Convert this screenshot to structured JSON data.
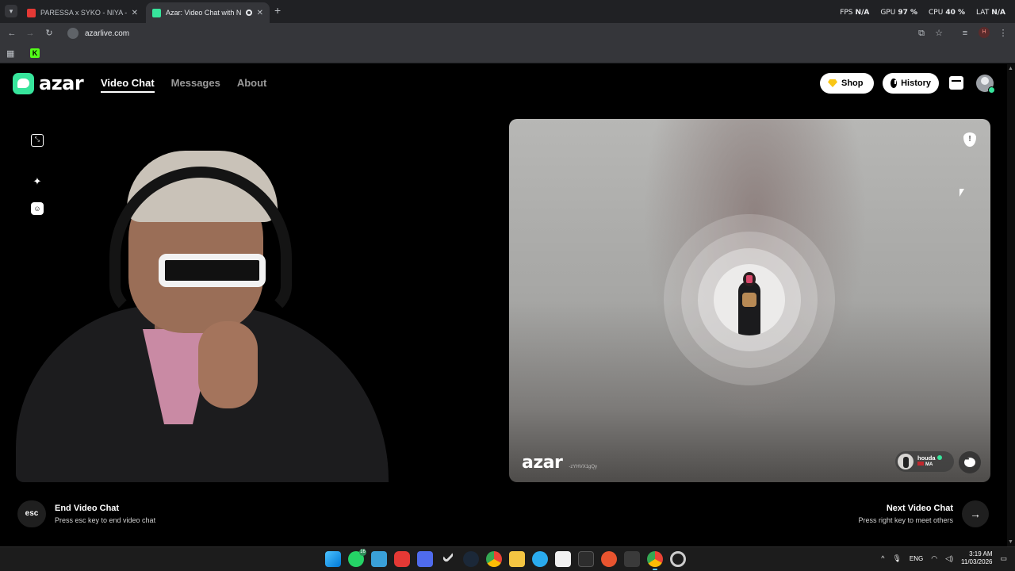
{
  "browser": {
    "tab_menu_icon": "chevron-down-icon",
    "tabs": [
      {
        "title": "PARESSA x SYKO - NIYA - (Prod",
        "favicon_color": "#e53935",
        "active": false
      },
      {
        "title": "Azar: Video Chat with New",
        "favicon_color": "#37e59c",
        "active": true
      }
    ],
    "stats": [
      {
        "label": "FPS",
        "value": "N/A"
      },
      {
        "label": "GPU",
        "value": "97 %"
      },
      {
        "label": "CPU",
        "value": "40 %"
      },
      {
        "label": "LAT",
        "value": "N/A"
      }
    ],
    "url": "azarlive.com",
    "profile_initial": "H"
  },
  "nav": {
    "logo": "azar",
    "items": [
      {
        "label": "Video Chat",
        "active": true
      },
      {
        "label": "Messages",
        "active": false
      },
      {
        "label": "About",
        "active": false
      }
    ],
    "shop_label": "Shop",
    "history_label": "History"
  },
  "remote": {
    "watermark": "azar",
    "session_id": "-zYHVX1gQy",
    "user": {
      "name": "houda",
      "country": "MA"
    }
  },
  "controls": {
    "end": {
      "key": "esc",
      "title": "End Video Chat",
      "subtitle": "Press esc key to end video chat"
    },
    "next": {
      "title": "Next Video Chat",
      "subtitle": "Press right key to meet others"
    }
  },
  "taskbar": {
    "language": "ENG",
    "time": "3:19 AM",
    "date": "11/03/2026",
    "whatsapp_badge": "16",
    "icons": [
      "windows-start-icon",
      "whatsapp-icon",
      "file-app-icon",
      "youtube-icon",
      "app-icon",
      "checkmark-icon",
      "steam-icon",
      "chrome-icon",
      "folder-icon",
      "telegram-icon",
      "store-icon",
      "terminal-icon",
      "obs-icon",
      "app-dark-icon",
      "chrome-active-icon",
      "settings-icon"
    ]
  }
}
